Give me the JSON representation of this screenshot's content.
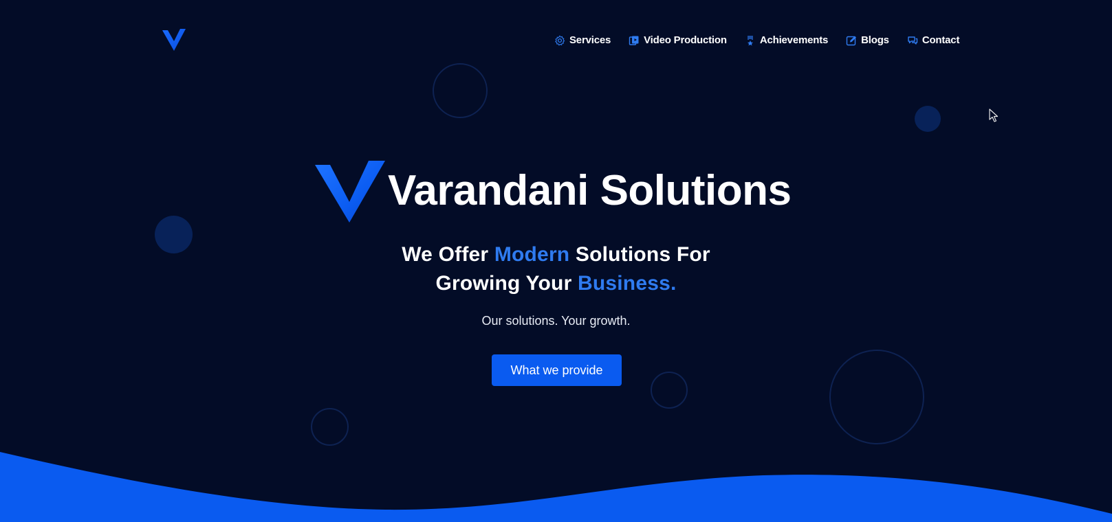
{
  "nav": {
    "logo_icon": "v-logo-icon",
    "items": [
      {
        "label": "Services",
        "icon": "gear-icon"
      },
      {
        "label": "Video Production",
        "icon": "video-icon"
      },
      {
        "label": "Achievements",
        "icon": "medal-icon"
      },
      {
        "label": "Blogs",
        "icon": "edit-icon"
      },
      {
        "label": "Contact",
        "icon": "chat-icon"
      }
    ]
  },
  "hero": {
    "title": "Varandani Solutions",
    "tagline_parts": [
      "We Offer ",
      "Modern",
      " Solutions For",
      "Growing Your ",
      "Business."
    ],
    "subtitle": "Our solutions. Your growth.",
    "cta_label": "What we provide"
  },
  "colors": {
    "background": "#030c27",
    "accent": "#2f7bf0",
    "button": "#0a5bf0",
    "wave": "#0a5bf0"
  }
}
